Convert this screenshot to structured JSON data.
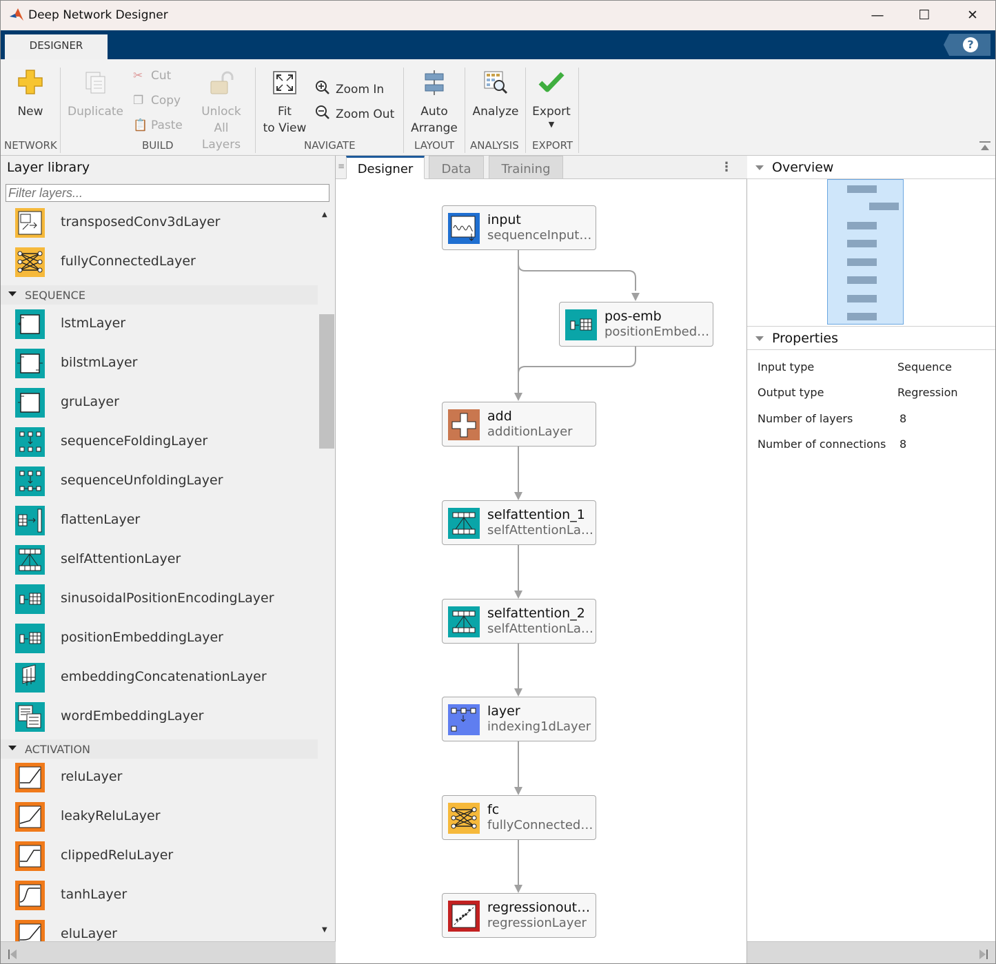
{
  "window": {
    "title": "Deep Network Designer",
    "minimize": "—",
    "maximize": "☐",
    "close": "✕"
  },
  "ribbon": {
    "tab": "DESIGNER",
    "help": "?",
    "buttons": {
      "new": "New",
      "duplicate": "Duplicate",
      "cut": "Cut",
      "copy": "Copy",
      "paste": "Paste",
      "unlock_1": "Unlock",
      "unlock_2": "All Layers",
      "fit_1": "Fit",
      "fit_2": "to View",
      "zoom_in": "Zoom In",
      "zoom_out": "Zoom Out",
      "auto_1": "Auto",
      "auto_2": "Arrange",
      "analyze": "Analyze",
      "export": "Export"
    },
    "sections": {
      "network": "NETWORK",
      "build": "BUILD",
      "navigate": "NAVIGATE",
      "layout": "LAYOUT",
      "analysis": "ANALYSIS",
      "export": "EXPORT"
    }
  },
  "library": {
    "title": "Layer library",
    "filter_placeholder": "Filter layers...",
    "top_items": [
      "transposedConv3dLayer",
      "fullyConnectedLayer"
    ],
    "sequence_header": "SEQUENCE",
    "sequence_items": [
      "lstmLayer",
      "bilstmLayer",
      "gruLayer",
      "sequenceFoldingLayer",
      "sequenceUnfoldingLayer",
      "flattenLayer",
      "selfAttentionLayer",
      "sinusoidalPositionEncodingLayer",
      "positionEmbeddingLayer",
      "embeddingConcatenationLayer",
      "wordEmbeddingLayer"
    ],
    "activation_header": "ACTIVATION",
    "activation_items": [
      "reluLayer",
      "leakyReluLayer",
      "clippedReluLayer",
      "tanhLayer",
      "eluLayer"
    ]
  },
  "canvas": {
    "tabs": [
      "Designer",
      "Data",
      "Training"
    ],
    "nodes": [
      {
        "name": "input",
        "type": "sequenceInput…"
      },
      {
        "name": "pos-emb",
        "type": "positionEmbed…"
      },
      {
        "name": "add",
        "type": "additionLayer"
      },
      {
        "name": "selfattention_1",
        "type": "selfAttentionLa…"
      },
      {
        "name": "selfattention_2",
        "type": "selfAttentionLa…"
      },
      {
        "name": "layer",
        "type": "indexing1dLayer"
      },
      {
        "name": "fc",
        "type": "fullyConnected…"
      },
      {
        "name": "regressionout…",
        "type": "regressionLayer"
      }
    ]
  },
  "overview": {
    "title": "Overview"
  },
  "properties": {
    "title": "Properties",
    "rows": [
      {
        "label": "Input type",
        "value": "Sequence"
      },
      {
        "label": "Output type",
        "value": "Regression"
      },
      {
        "label": "Number of layers",
        "value": "8"
      },
      {
        "label": "Number of connections",
        "value": "8"
      }
    ]
  },
  "colors": {
    "ribbon_blue": "#003a6c",
    "teal": "#0aa5a8",
    "orange": "#f07a1a",
    "yellow": "#f6b93b",
    "brown": "#c9774f",
    "indigo": "#5f7ef0",
    "red": "#c32121"
  }
}
